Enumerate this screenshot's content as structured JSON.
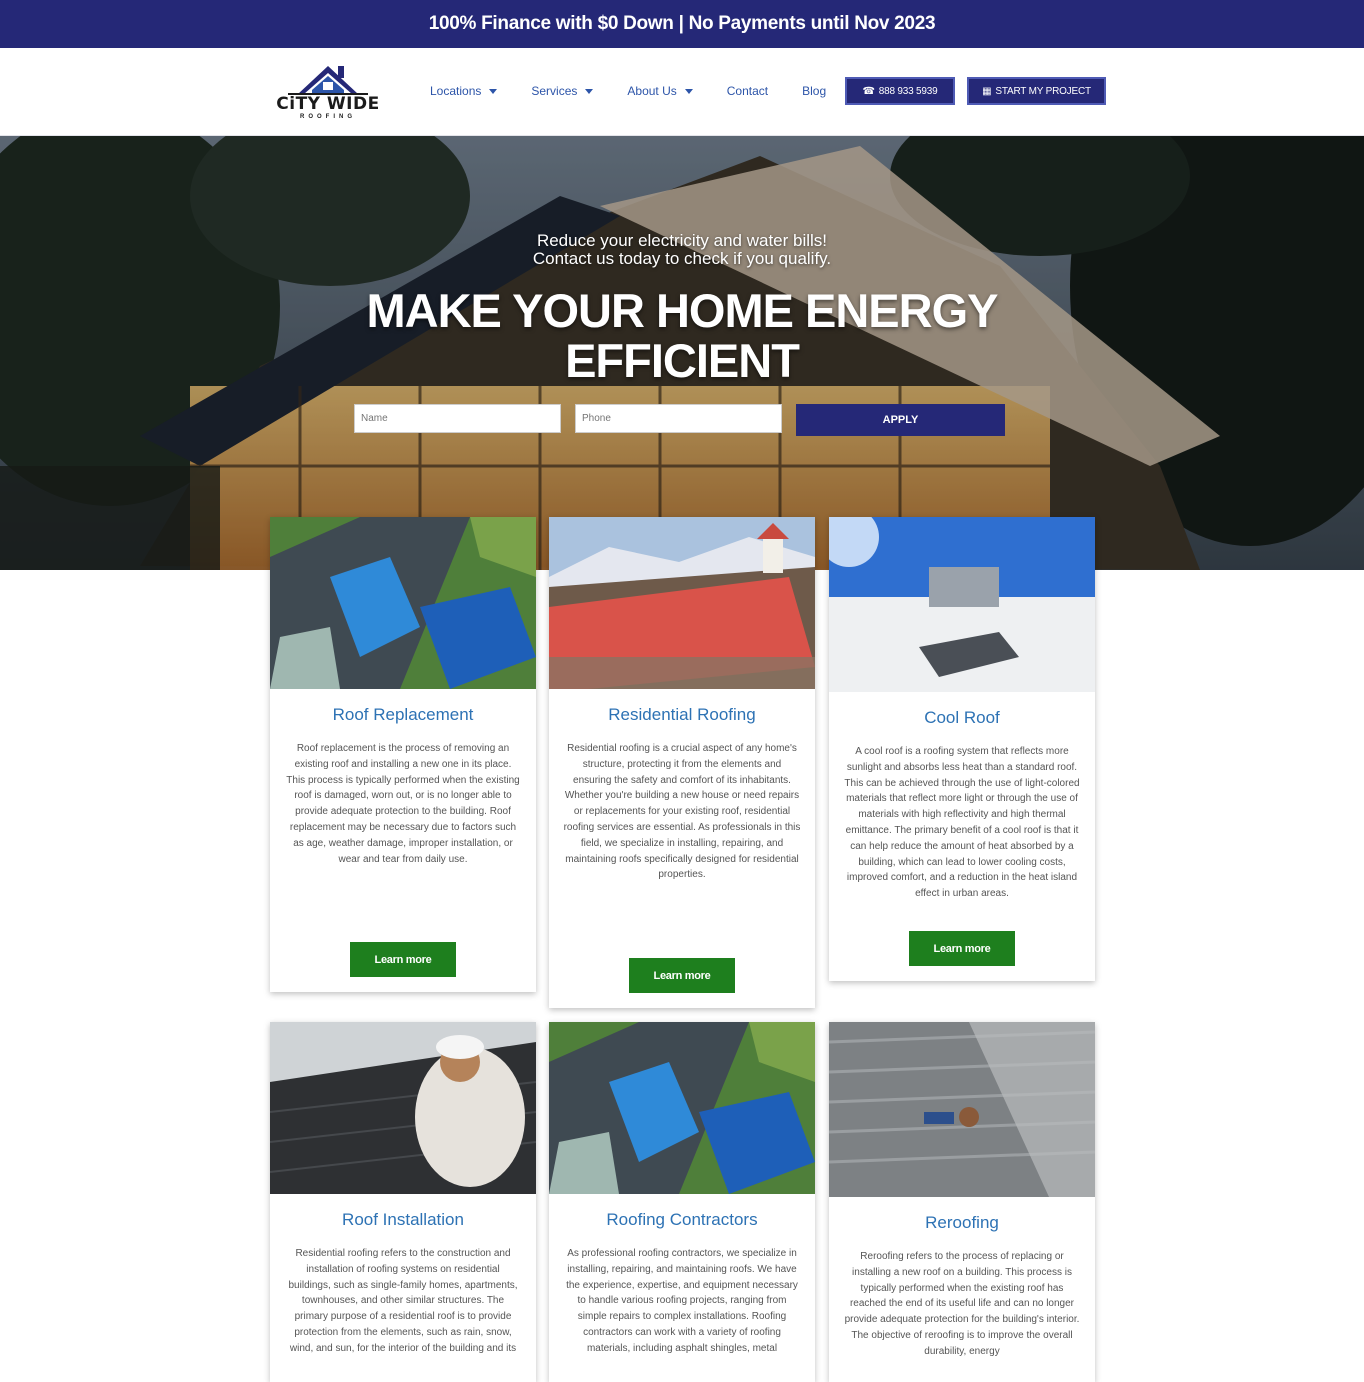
{
  "promo": {
    "text": "100% Finance with $0 Down | No Payments until Nov 2023"
  },
  "logo": {
    "name": "CiTY WIDE",
    "sub": "ROOFING"
  },
  "nav": {
    "items": [
      {
        "label": "Locations",
        "dropdown": true
      },
      {
        "label": "Services",
        "dropdown": true
      },
      {
        "label": "About Us",
        "dropdown": true
      },
      {
        "label": "Contact",
        "dropdown": false
      },
      {
        "label": "Blog",
        "dropdown": false
      }
    ],
    "phone_label": "888 933 5939",
    "project_label": "START MY PROJECT"
  },
  "hero": {
    "subtitle_line1": "Reduce your electricity and water bills!",
    "subtitle_line2": "Contact us today to check if you qualify.",
    "title_line1": "MAKE YOUR HOME ENERGY",
    "title_line2": "EFFICIENT",
    "name_placeholder": "Name",
    "phone_placeholder": "Phone",
    "apply_label": "APPLY"
  },
  "cards": [
    {
      "title": "Roof Replacement",
      "text": "Roof replacement is the process of removing an existing roof and installing a new one in its place. This process is typically performed when the existing roof is damaged, worn out, or is no longer able to provide adequate protection to the building. Roof replacement may be necessary due to factors such as age, weather damage, improper installation, or wear and tear from daily use.",
      "button": "Learn more"
    },
    {
      "title": "Residential Roofing",
      "text": "Residential roofing is a crucial aspect of any home's structure, protecting it from the elements and ensuring the safety and comfort of its inhabitants. Whether you're building a new house or need repairs or replacements for your existing roof, residential roofing services are essential. As professionals in this field, we specialize in installing, repairing, and maintaining roofs specifically designed for residential properties.",
      "button": "Learn more"
    },
    {
      "title": "Cool Roof",
      "text": "A cool roof is a roofing system that reflects more sunlight and absorbs less heat than a standard roof. This can be achieved through the use of light-colored materials that reflect more light or through the use of materials with high reflectivity and high thermal emittance. The primary benefit of a cool roof is that it can help reduce the amount of heat absorbed by a building, which can lead to lower cooling costs, improved comfort, and a reduction in the heat island effect in urban areas.",
      "button": "Learn more"
    },
    {
      "title": "Roof Installation",
      "text": "Residential roofing refers to the construction and installation of roofing systems on residential buildings, such as single-family homes, apartments, townhouses, and other similar structures. The primary purpose of a residential roof is to provide protection from the elements, such as rain, snow, wind, and sun, for the interior of the building and its"
    },
    {
      "title": "Roofing Contractors",
      "text": "As professional roofing contractors, we specialize in installing, repairing, and maintaining roofs. We have the experience, expertise, and equipment necessary to handle various roofing projects, ranging from simple repairs to complex installations. Roofing contractors can work with a variety of roofing materials, including asphalt shingles, metal"
    },
    {
      "title": "Reroofing",
      "text": "Reroofing refers to the process of replacing or installing a new roof on a building. This process is typically performed when the existing roof has reached the end of its useful life and can no longer provide adequate protection for the building's interior. The objective of reroofing is to improve the overall durability, energy"
    }
  ]
}
